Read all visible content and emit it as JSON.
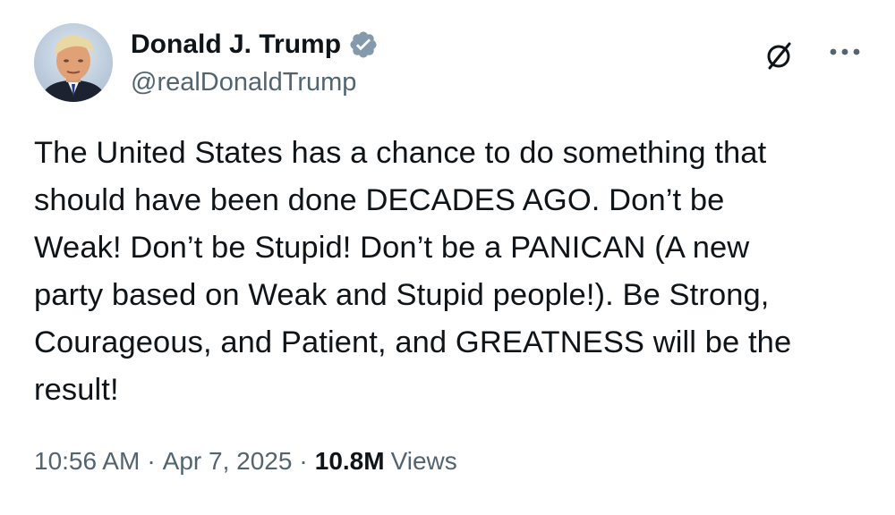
{
  "author": {
    "display_name": "Donald J. Trump",
    "handle": "@realDonaldTrump",
    "verified": true,
    "verified_color": "#829aab"
  },
  "header_actions": {
    "grok_icon": "grok-slash-circle-icon",
    "more_icon": "more-dots-icon"
  },
  "tweet": {
    "lines": [
      "The United States has a chance to do something that",
      "should have been done DECADES AGO. Don’t be",
      "Weak! Don’t be Stupid! Don’t be a PANICAN (A new",
      "party based on Weak and Stupid people!). Be Strong,",
      "Courageous, and Patient, and GREATNESS will be the",
      "result!"
    ]
  },
  "meta": {
    "time": "10:56 AM",
    "separator": "·",
    "date": "Apr 7, 2025",
    "views_count": "10.8M",
    "views_label": "Views"
  },
  "colors": {
    "text": "#0f1419",
    "secondary": "#536471",
    "background": "#ffffff"
  }
}
